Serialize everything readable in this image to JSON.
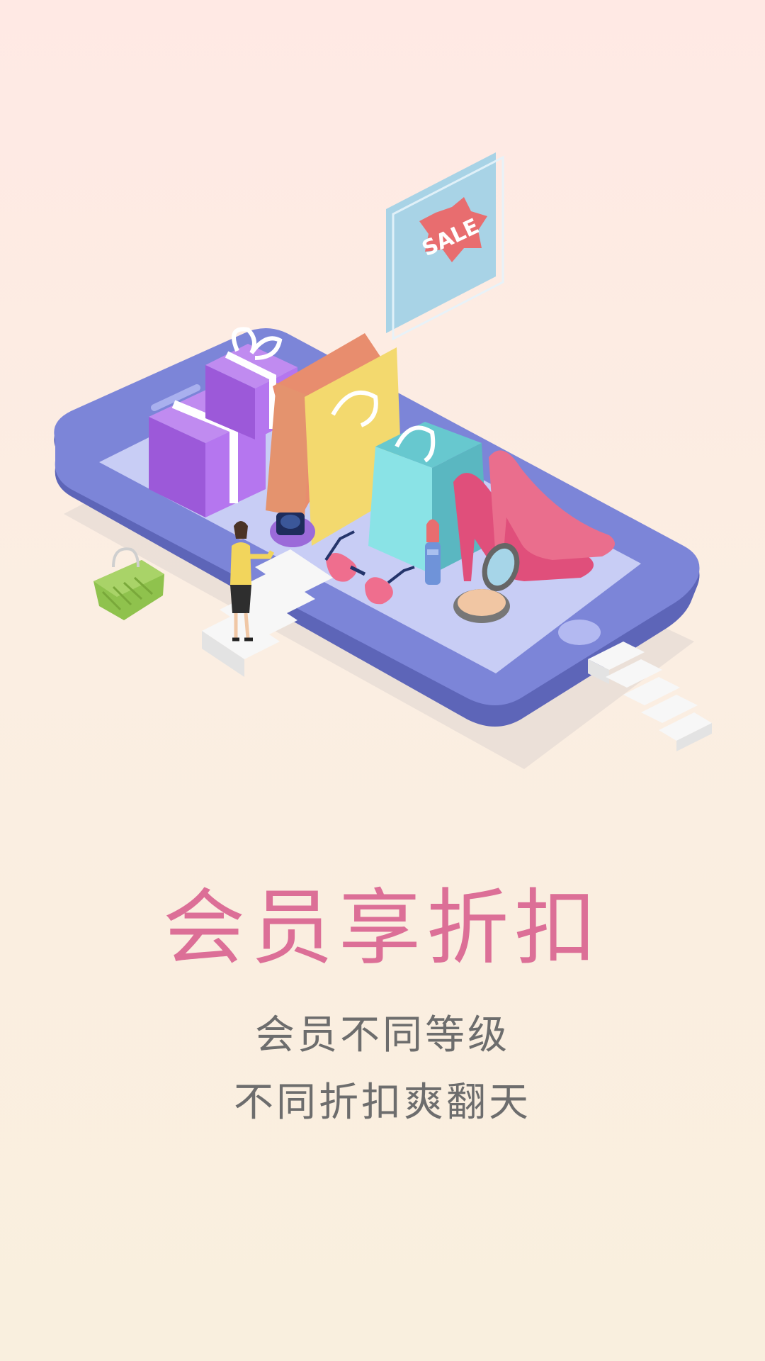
{
  "illustration": {
    "sale_tag": "SALE",
    "icons": [
      "phone-illustration",
      "gift-box-icon",
      "shopping-bag-icon",
      "high-heels-icon",
      "lipstick-icon",
      "compact-mirror-icon",
      "sunglasses-icon",
      "watch-icon",
      "basket-icon",
      "woman-figure",
      "stairs"
    ]
  },
  "content": {
    "title": "会员享折扣",
    "subtitle_line1": "会员不同等级",
    "subtitle_line2": "不同折扣爽翻天"
  },
  "colors": {
    "title": "#dc6f97",
    "subtitle": "#6d6d6d",
    "phone": "#7a82d6",
    "screen": "#c6ccf4"
  }
}
